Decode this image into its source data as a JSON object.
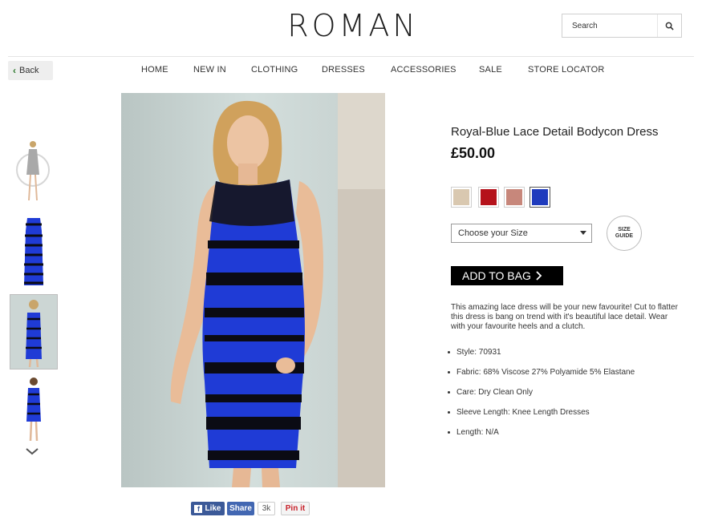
{
  "header": {
    "logo": "ROMAN",
    "search_placeholder": "Search"
  },
  "back_label": "Back",
  "nav": [
    "HOME",
    "NEW IN",
    "CLOTHING",
    "DRESSES",
    "ACCESSORIES",
    "SALE",
    "STORE LOCATOR"
  ],
  "product": {
    "title": "Royal-Blue Lace Detail Bodycon Dress",
    "price": "£50.00",
    "size_select": "Choose your Size",
    "size_guide_line1": "SIZE",
    "size_guide_line2": "GUIDE",
    "add_to_bag": "ADD TO BAG",
    "description": "This amazing lace dress will be your new favourite! Cut to flatter this dress is bang on trend with it's beautiful lace detail. Wear with your favourite heels and a clutch.",
    "specs": [
      "Style: 70931",
      "Fabric: 68% Viscose 27% Polyamide 5% Elastane",
      "Care: Dry Clean Only",
      "Sleeve Length: Knee Length Dresses",
      "Length: N/A"
    ],
    "swatch_colors": [
      "#d9c8b0",
      "#b5121b",
      "#c7877b",
      "#1f3bbd"
    ]
  },
  "social": {
    "like": "Like",
    "share": "Share",
    "count": "3k",
    "pin": "Pin it"
  },
  "colors": {
    "dress_blue": "#1f3bd6",
    "dress_black": "#0b0b14",
    "nav_text": "#333333",
    "facebook": "#3b5998"
  }
}
